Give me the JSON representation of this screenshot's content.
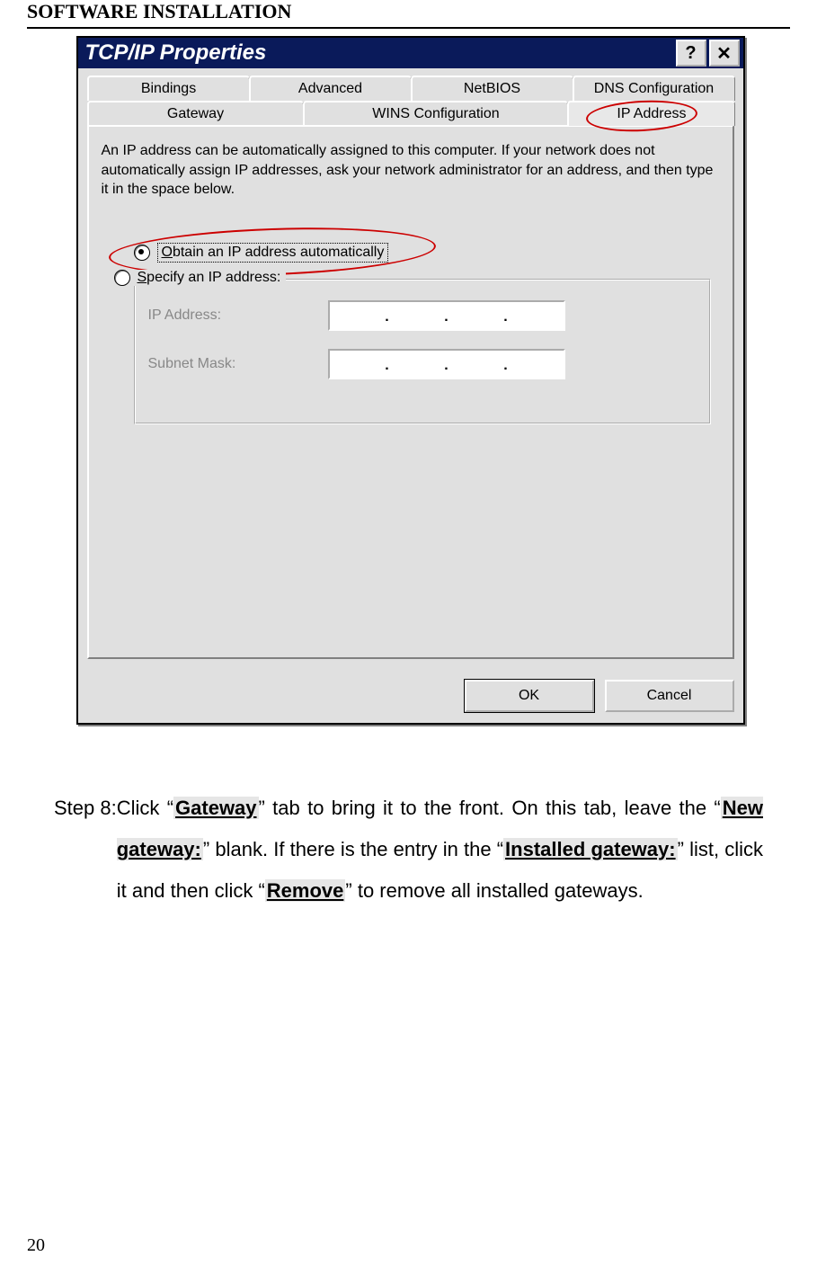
{
  "header": "SOFTWARE INSTALLATION",
  "page_number": "20",
  "dialog": {
    "title": "TCP/IP Properties",
    "help_btn": "?",
    "close_btn": "✕",
    "tabs_row1": [
      "Bindings",
      "Advanced",
      "NetBIOS",
      "DNS Configuration"
    ],
    "tabs_row2": [
      "Gateway",
      "WINS Configuration",
      "IP Address"
    ],
    "description": "An IP address can be automatically assigned to this computer. If your network does not automatically assign IP addresses, ask your network administrator for an address, and then type it in the space below.",
    "radio_auto": "Obtain an IP address automatically",
    "radio_specify": "Specify an IP address:",
    "label_ip": "IP Address:",
    "label_mask": "Subnet Mask:",
    "ok": "OK",
    "cancel": "Cancel"
  },
  "step": {
    "label": "Step 8:",
    "t1": "Click “",
    "gateway": "Gateway",
    "t2": "” tab to bring it to the front. On this tab, leave the “",
    "new_gw": "New gateway:",
    "t3": "” blank. If there is the entry in the “",
    "inst_gw": "Installed gateway:",
    "t4": "” list, click it and then click “",
    "remove": "Remove",
    "t5": "” to remove all installed gateways."
  }
}
